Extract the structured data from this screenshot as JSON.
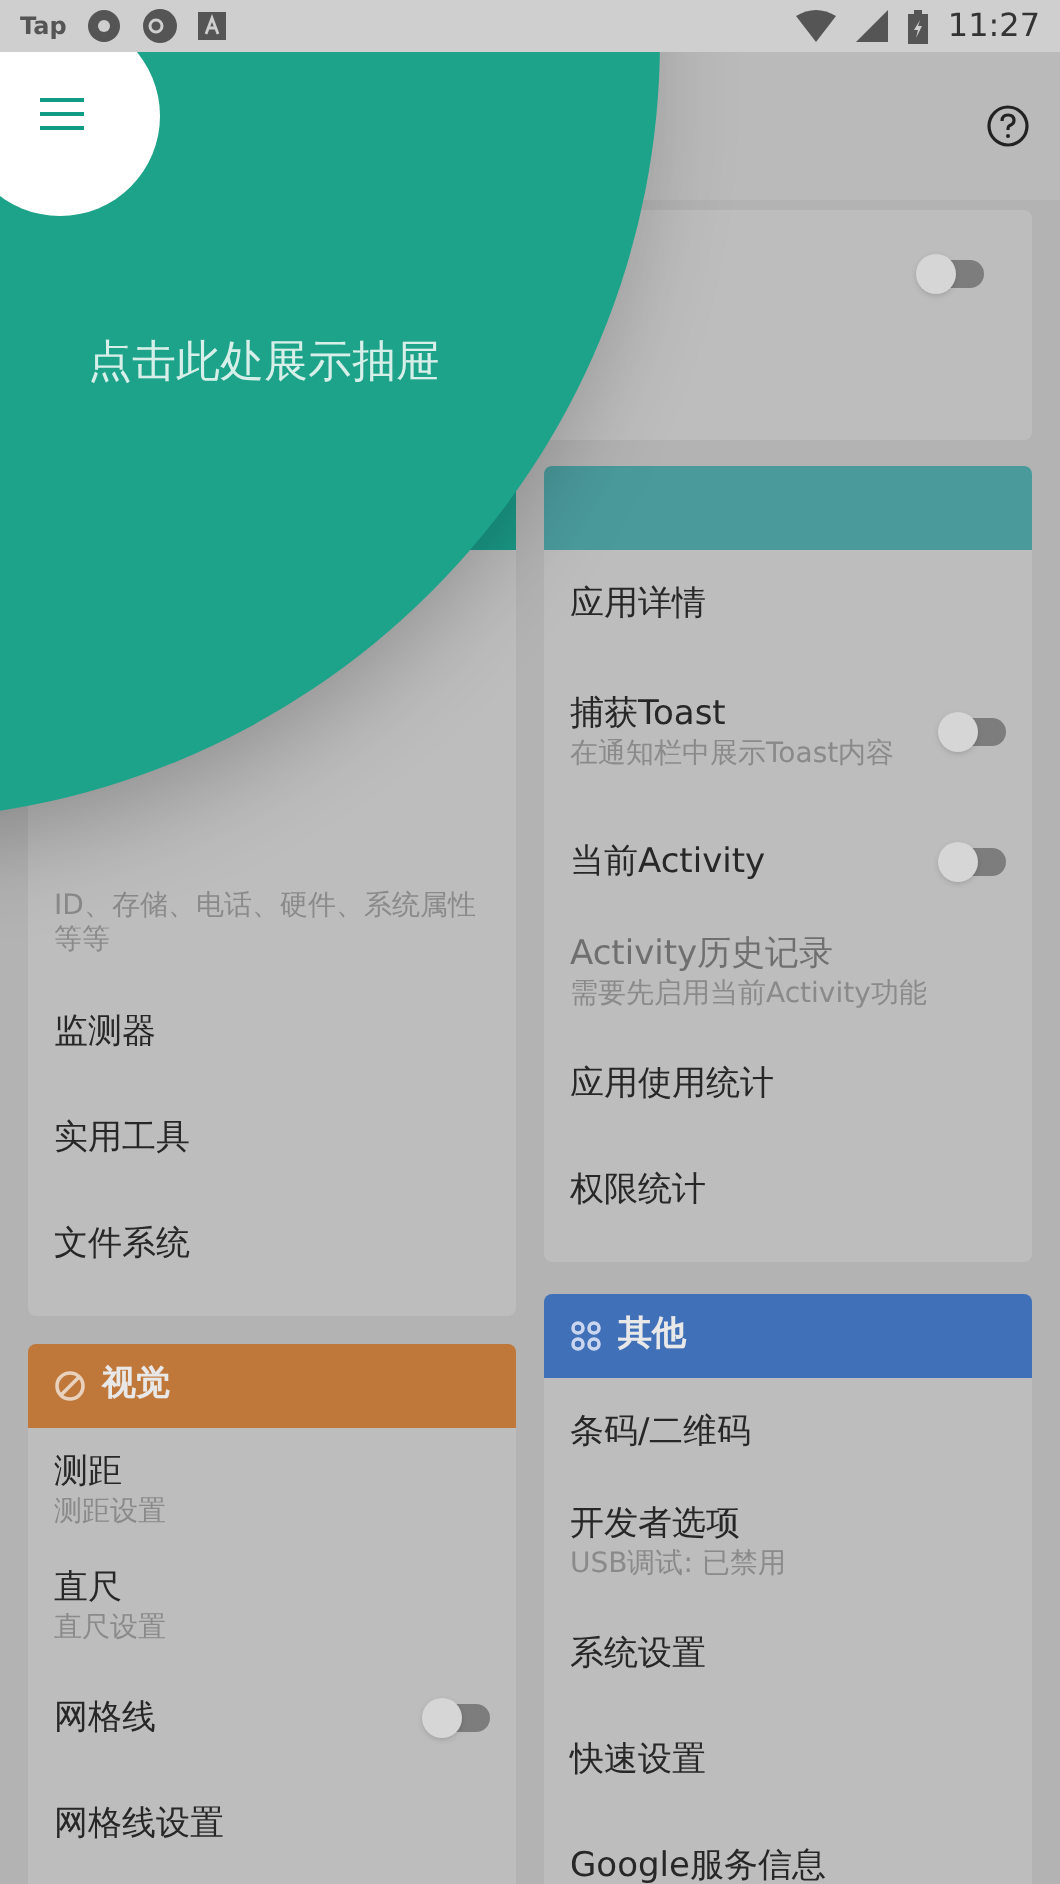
{
  "status_bar": {
    "app_label": "Tap",
    "time": "11:27"
  },
  "floating_card": {
    "toggle": {
      "on": false
    }
  },
  "columns": [
    {
      "cards": [
        {
          "header": {
            "color": "#1a9a87"
          },
          "items": [
            {
              "kind": "subtitle_only",
              "subtitle": "ID、存储、电话、硬件、系统属性等等"
            },
            {
              "kind": "link",
              "title": "监测器"
            },
            {
              "kind": "link",
              "title": "实用工具"
            },
            {
              "kind": "link",
              "title": "文件系统"
            }
          ]
        },
        {
          "header": {
            "color": "#c0773a",
            "title": "视觉"
          },
          "items": [
            {
              "kind": "link",
              "title": "测距",
              "subtitle": "测距设置"
            },
            {
              "kind": "link",
              "title": "直尺",
              "subtitle": "直尺设置"
            },
            {
              "kind": "toggle",
              "title": "网格线",
              "on": false
            },
            {
              "kind": "link",
              "title": "网格线设置"
            }
          ]
        }
      ]
    },
    {
      "cards": [
        {
          "header": {
            "color": "#4a9a9c"
          },
          "items": [
            {
              "kind": "link",
              "title": "应用详情"
            },
            {
              "kind": "toggle",
              "title": "捕获Toast",
              "subtitle": "在通知栏中展示Toast内容",
              "on": false
            },
            {
              "kind": "toggle",
              "title": "当前Activity",
              "on": false
            },
            {
              "kind": "link",
              "title": "Activity历史记录",
              "subtitle": "需要先启用当前Activity功能",
              "disabled": true
            },
            {
              "kind": "link",
              "title": "应用使用统计"
            },
            {
              "kind": "link",
              "title": "权限统计"
            }
          ]
        },
        {
          "header": {
            "color": "#4070b8",
            "title": "其他"
          },
          "items": [
            {
              "kind": "link",
              "title": "条码/二维码"
            },
            {
              "kind": "link",
              "title": "开发者选项",
              "subtitle": "USB调试: 已禁用"
            },
            {
              "kind": "link",
              "title": "系统设置"
            },
            {
              "kind": "link",
              "title": "快速设置"
            },
            {
              "kind": "link",
              "title": "Google服务信息"
            }
          ]
        }
      ]
    }
  ],
  "coach_mark": {
    "hint": "点击此处展示抽屉"
  }
}
